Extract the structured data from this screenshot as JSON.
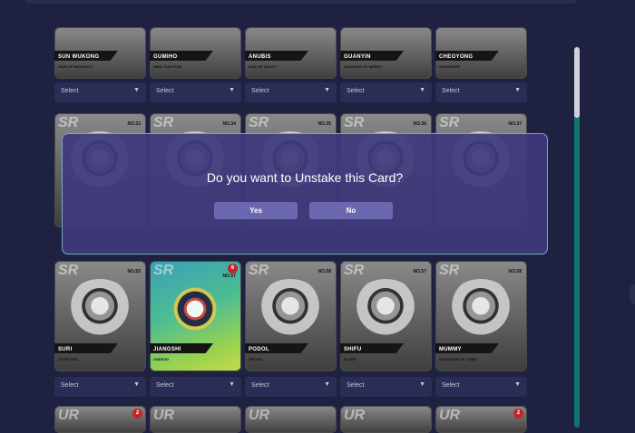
{
  "modal": {
    "question": "Do you want to Unstake this Card?",
    "yes_label": "Yes",
    "no_label": "No"
  },
  "select_placeholder": "Select",
  "row1": [
    {
      "name": "SUN WUKONG",
      "sub": "KING OF MONKEYS"
    },
    {
      "name": "GUMIHO",
      "sub": "NINE TAILS FOX"
    },
    {
      "name": "ANUBIS",
      "sub": "GOD OF DEATH"
    },
    {
      "name": "GUANYIN",
      "sub": "GODDESS OF MERCY"
    },
    {
      "name": "CHEOYONG",
      "sub": "SORCERER"
    }
  ],
  "row2_numbers": [
    "NO.33",
    "NO.34",
    "NO.35",
    "NO.36",
    "NO.37"
  ],
  "row3": [
    {
      "name": "SURI",
      "sub": "CUTIE OWL",
      "number": "NO.55",
      "badge": ""
    },
    {
      "name": "JIANGSHI",
      "sub": "UNDEAD",
      "number": "NO.57",
      "badge": "6"
    },
    {
      "name": "PODOL",
      "sub": "TRYING",
      "number": "NO.58",
      "badge": ""
    },
    {
      "name": "SHIFU",
      "sub": "ELDER",
      "number": "NO.57",
      "badge": ""
    },
    {
      "name": "MUMMY",
      "sub": "GUARDIAN OF TOMB",
      "number": "NO.58",
      "badge": ""
    }
  ],
  "row4_badges": [
    "2",
    "",
    "",
    "",
    "2"
  ],
  "colors": {
    "background": "#1f2140",
    "modal": "#3e3a7d",
    "button": "#6b68b0",
    "scroll_track": "#13746d",
    "badge": "#c4242a"
  }
}
